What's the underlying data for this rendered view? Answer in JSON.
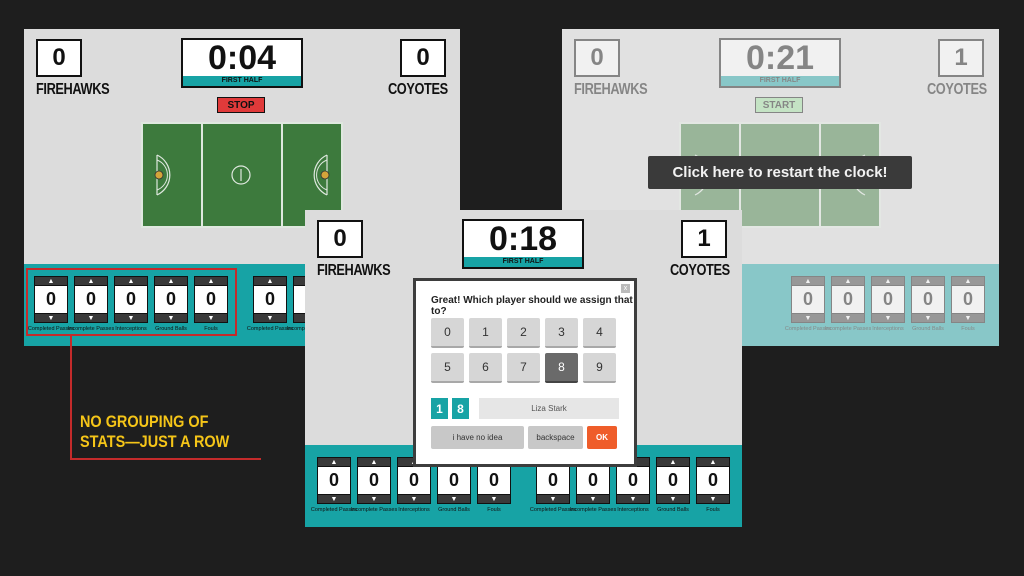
{
  "colors": {
    "teal": "#17a3a5",
    "stop": "#e03a3a",
    "start": "#9be09b",
    "ok": "#ef5d2a",
    "annotation": "#f5c518",
    "field": "#3d7a3d"
  },
  "left_panel": {
    "home_score": "0",
    "home_team": "FIREHAWKS",
    "away_score": "0",
    "away_team": "COYOTES",
    "clock": "0:04",
    "half": "FIRST HALF",
    "button": "STOP"
  },
  "right_panel": {
    "home_score": "0",
    "home_team": "FIREHAWKS",
    "away_score": "1",
    "away_team": "COYOTES",
    "clock": "0:21",
    "half": "FIRST HALF",
    "button": "START",
    "tooltip": "Click here to restart the clock!"
  },
  "center_panel": {
    "home_score": "0",
    "home_team": "FIREHAWKS",
    "away_score": "1",
    "away_team": "COYOTES",
    "clock": "0:18",
    "half": "FIRST HALF"
  },
  "stat_labels": [
    "Completed Passes",
    "Incomplete Passes",
    "Interceptions",
    "Ground Balls",
    "Fouls"
  ],
  "stat_values": [
    "0",
    "0",
    "0",
    "0",
    "0"
  ],
  "arrows": {
    "up": "▲",
    "down": "▼"
  },
  "dialog": {
    "title": "Great! Which player should we assign that to?",
    "close": "x",
    "keys": [
      "0",
      "1",
      "2",
      "3",
      "4",
      "5",
      "6",
      "7",
      "8",
      "9"
    ],
    "selected_key": "8",
    "entered_digits": [
      "1",
      "8"
    ],
    "player_name": "Liza Stark",
    "no_idea": "i have no idea",
    "backspace": "backspace",
    "ok": "OK"
  },
  "annotation": {
    "line1": "NO GROUPING OF",
    "line2": "STATS—JUST A ROW"
  }
}
